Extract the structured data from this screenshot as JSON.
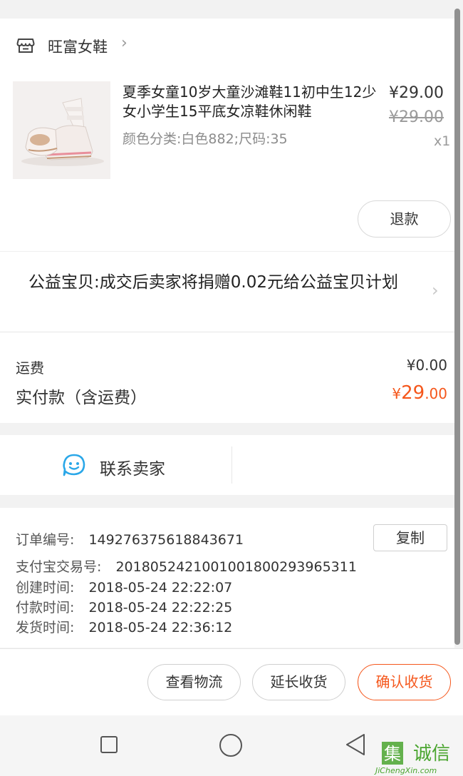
{
  "shop": {
    "name": "旺富女鞋",
    "icon": "store-icon",
    "chevron": "›"
  },
  "product": {
    "title": "夏季女童10岁大童沙滩鞋11初中生12少女小学生15平底女凉鞋休闲鞋",
    "spec": "颜色分类:白色882;尺码:35",
    "price": "¥29.00",
    "original_price": "¥29.00",
    "quantity": "x1",
    "refund_label": "退款"
  },
  "charity": {
    "text": "公益宝贝:成交后卖家将捐赠0.02元给公益宝贝计划",
    "chevron": "›"
  },
  "fees": {
    "shipping_label": "运费",
    "shipping_value": "¥0.00",
    "paid_label": "实付款（含运费）",
    "paid_symbol": "¥",
    "paid_integer": "29",
    "paid_decimal": ".00"
  },
  "contact": {
    "label": "联系卖家",
    "icon": "chat-bubble-icon"
  },
  "order_info": {
    "order_no_label": "订单编号:",
    "order_no": "149276375618843671",
    "copy_label": "复制",
    "alipay_label": "支付宝交易号:",
    "alipay_no": "2018052421001001800293965311",
    "created_label": "创建时间:",
    "created_time": "2018-05-24 22:22:07",
    "paid_time_label": "付款时间:",
    "paid_time": "2018-05-24 22:22:25",
    "shipped_label": "发货时间:",
    "shipped_time": "2018-05-24 22:36:12"
  },
  "actions": {
    "logistics": "查看物流",
    "extend": "延长收货",
    "confirm": "确认收货"
  },
  "watermark": {
    "text": "集诚信",
    "domain": "JiChengXin.com"
  },
  "colors": {
    "accent": "#f5571c",
    "chat_icon": "#2aa7e8",
    "text": "#333333"
  }
}
